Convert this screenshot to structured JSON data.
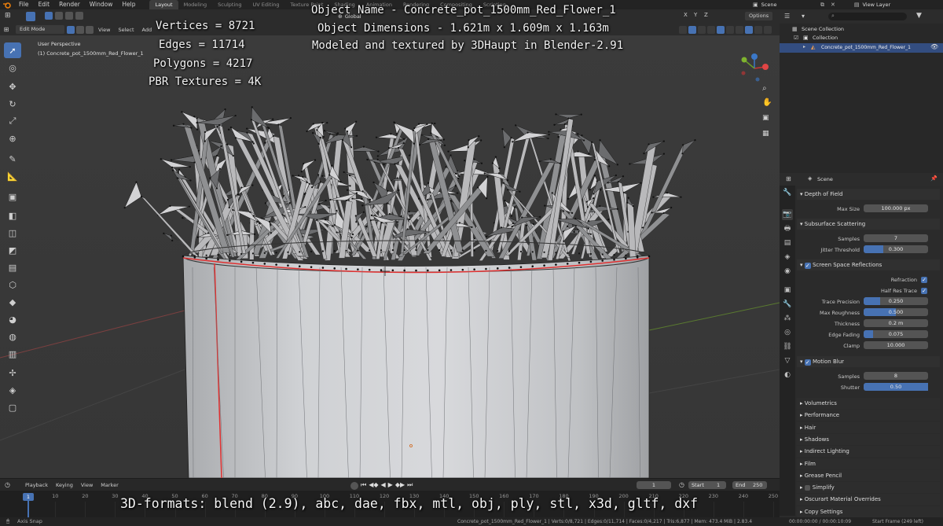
{
  "menu": {
    "items": [
      "File",
      "Edit",
      "Render",
      "Window",
      "Help"
    ],
    "workspaces": [
      "Layout",
      "Modeling",
      "Sculpting",
      "UV Editing",
      "Texture Paint",
      "Shading",
      "Animation",
      "Rendering",
      "Compositing",
      "Scripting"
    ],
    "active_workspace": "Layout",
    "scene_name": "Scene",
    "view_layer": "View Layer"
  },
  "viewport_header": {
    "mode": "Edit Mode",
    "view": "View",
    "select": "Select",
    "add": "Add",
    "transform_orientation": "Global",
    "options": "Options"
  },
  "viewport": {
    "perspective_label": "User Perspective",
    "object_label": "(1) Concrete_pot_1500mm_Red_Flower_1"
  },
  "overlay": {
    "vertices": "Vertices = 8721",
    "edges": "Edges = 11714",
    "polygons": "Polygons = 4217",
    "textures": "PBR Textures = 4K",
    "object_name": "Object Name - Concrete_pot_1500mm_Red_Flower_1",
    "dimensions": "Object Dimensions -  1.621m x 1.609m x 1.163m",
    "modeled_by": "Modeled and textured by 3DHaupt in Blender-2.91",
    "formats": "3D-formats: blend (2.9), abc, dae, fbx, mtl, obj, ply, stl, x3d, gltf, dxf"
  },
  "outliner": {
    "scene_collection": "Scene Collection",
    "collection": "Collection",
    "object": "Concrete_pot_1500mm_Red_Flower_1"
  },
  "properties": {
    "context": "Scene",
    "depth_of_field": {
      "title": "Depth of Field",
      "max_size_label": "Max Size",
      "max_size": "100.000 px"
    },
    "sss": {
      "title": "Subsurface Scattering",
      "samples_label": "Samples",
      "samples": "7",
      "jitter_label": "Jitter Threshold",
      "jitter": "0.300",
      "jitter_fraction": 0.3
    },
    "ssr": {
      "title": "Screen Space Reflections",
      "refraction_label": "Refraction",
      "half_res_label": "Half Res Trace",
      "trace_precision_label": "Trace Precision",
      "trace_precision": "0.250",
      "trace_precision_fraction": 0.25,
      "max_roughness_label": "Max Roughness",
      "max_roughness": "0.500",
      "max_roughness_fraction": 0.5,
      "thickness_label": "Thickness",
      "thickness": "0.2 m",
      "edge_fading_label": "Edge Fading",
      "edge_fading": "0.075",
      "edge_fading_fraction": 0.15,
      "clamp_label": "Clamp",
      "clamp": "10.000"
    },
    "motion_blur": {
      "title": "Motion Blur",
      "samples_label": "Samples",
      "samples": "8",
      "shutter_label": "Shutter",
      "shutter": "0.50",
      "shutter_fraction": 1.0
    },
    "closed_panels": [
      "Volumetrics",
      "Performance",
      "Hair",
      "Shadows",
      "Indirect Lighting",
      "Film",
      "Grease Pencil",
      "Simplify",
      "Oscurart Material Overrides",
      "Copy Settings"
    ]
  },
  "timeline": {
    "playback": "Playback",
    "keying": "Keying",
    "view": "View",
    "marker": "Marker",
    "current_frame": "1",
    "start_label": "Start",
    "start": "1",
    "end_label": "End",
    "end": "250",
    "ticks": [
      "1",
      "10",
      "20",
      "30",
      "40",
      "50",
      "60",
      "70",
      "80",
      "90",
      "100",
      "110",
      "120",
      "130",
      "140",
      "150",
      "160",
      "170",
      "180",
      "190",
      "200",
      "210",
      "220",
      "230",
      "240",
      "250"
    ]
  },
  "status": {
    "left": "Axis Snap",
    "stats": "Concrete_pot_1500mm_Red_Flower_1 | Verts:0/8,721 | Edges:0/11,714 | Faces:0/4,217 | Tris:6,877 | Mem: 473.4 MiB | 2.83.4",
    "time": "00:00:00:00 / 00:00:10:09",
    "start_frame": "Start Frame (249 left)"
  },
  "colors": {
    "accent": "#4772b3",
    "viewport_bg": "#3a3a3a",
    "seam_red": "#e03030",
    "panel_bg": "#2b2b2b"
  }
}
